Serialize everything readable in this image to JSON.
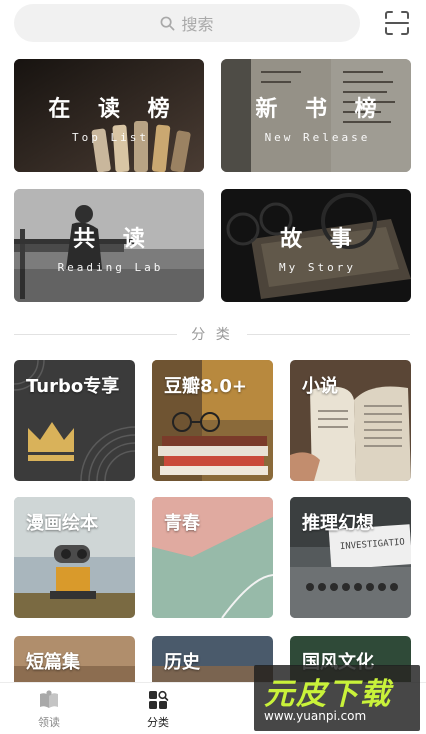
{
  "search": {
    "placeholder": "搜索",
    "icon": "search-icon"
  },
  "header": {
    "scan_icon": "scan-icon"
  },
  "banners": [
    {
      "title": "在 读 榜",
      "subtitle": "Top List"
    },
    {
      "title": "新 书 榜",
      "subtitle": "New Release"
    },
    {
      "title": "共 读",
      "subtitle": "Reading Lab"
    },
    {
      "title": "故 事",
      "subtitle": "My Story"
    }
  ],
  "section": {
    "label": "分 类"
  },
  "categories": [
    {
      "label": "Turbo专享"
    },
    {
      "label": "豆瓣8.0+"
    },
    {
      "label": "小说"
    },
    {
      "label": "漫画绘本"
    },
    {
      "label": "青春"
    },
    {
      "label": "推理幻想"
    },
    {
      "label": "短篇集"
    },
    {
      "label": "历史"
    },
    {
      "label": "国风文化"
    }
  ],
  "bottom_nav": [
    {
      "label": "领读",
      "icon": "book-icon",
      "active": false
    },
    {
      "label": "分类",
      "icon": "category-icon",
      "active": true
    }
  ],
  "watermark": {
    "text": "元皮下载",
    "url": "www.yuanpi.com"
  },
  "colors": {
    "watermark_green": "#c9f23a",
    "divider": "#e2e2e2"
  }
}
